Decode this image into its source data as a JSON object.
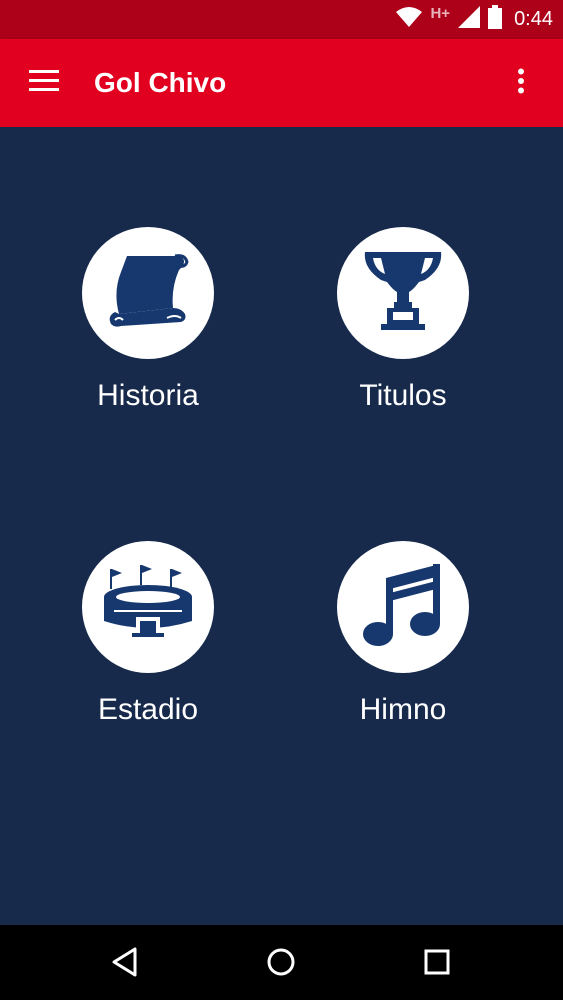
{
  "status_bar": {
    "time": "0:44",
    "network_type": "H+",
    "icons": [
      "wifi-icon",
      "signal-icon",
      "battery-icon"
    ]
  },
  "app_bar": {
    "title": "Gol Chivo",
    "menu_icon": "hamburger-menu-icon",
    "overflow_icon": "more-vertical-icon"
  },
  "menu": [
    {
      "label": "Historia",
      "icon": "scroll-icon"
    },
    {
      "label": "Titulos",
      "icon": "trophy-icon"
    },
    {
      "label": "Estadio",
      "icon": "stadium-icon"
    },
    {
      "label": "Himno",
      "icon": "music-note-icon"
    }
  ],
  "nav_bar": {
    "icons": [
      "back-icon",
      "home-icon",
      "recents-icon"
    ]
  },
  "colors": {
    "status_bar": "#ad0019",
    "app_bar": "#e1001f",
    "background": "#172a4b",
    "icon_blue": "#17386f",
    "text": "#ffffff"
  }
}
